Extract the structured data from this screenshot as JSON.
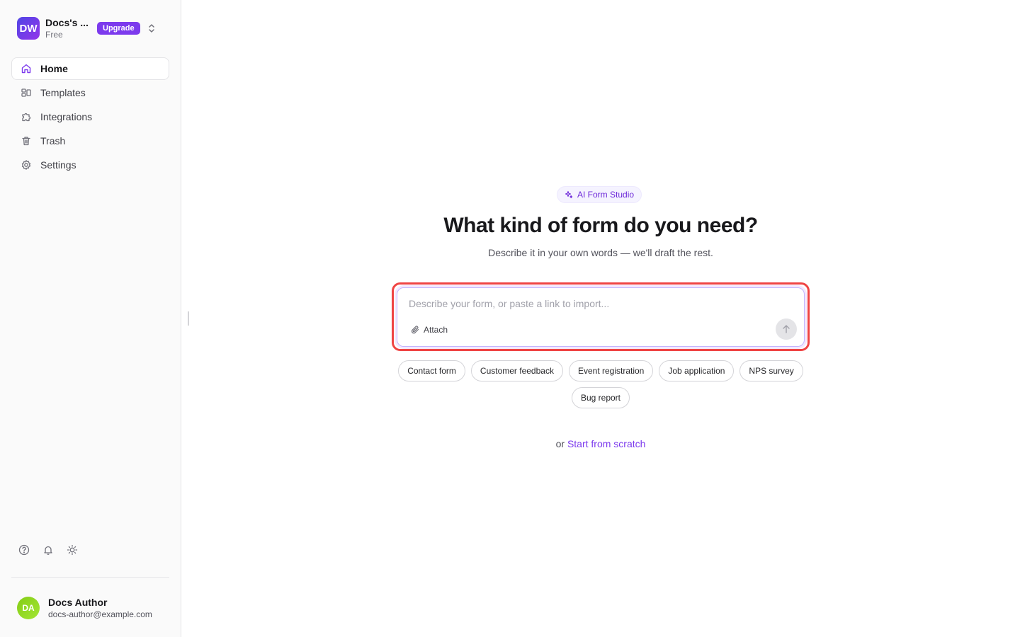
{
  "workspace": {
    "initials": "DW",
    "name": "Docs's ...",
    "plan": "Free",
    "upgrade_label": "Upgrade",
    "switcher_icon": "chevrons-up-down-icon"
  },
  "nav": {
    "items": [
      {
        "label": "Home",
        "icon": "home-icon",
        "active": true
      },
      {
        "label": "Templates",
        "icon": "templates-icon",
        "active": false
      },
      {
        "label": "Integrations",
        "icon": "puzzle-icon",
        "active": false
      },
      {
        "label": "Trash",
        "icon": "trash-icon",
        "active": false
      },
      {
        "label": "Settings",
        "icon": "gear-icon",
        "active": false
      }
    ]
  },
  "utility_icons": [
    "help-icon",
    "bell-icon",
    "sun-icon"
  ],
  "user": {
    "initials": "DA",
    "name": "Docs Author",
    "email": "docs-author@example.com"
  },
  "main": {
    "badge": "AI Form Studio",
    "title": "What kind of form do you need?",
    "subtitle": "Describe it in your own words — we'll draft the rest.",
    "prompt_placeholder": "Describe your form, or paste a link to import...",
    "prompt_value": "",
    "attach_label": "Attach",
    "suggestions": [
      "Contact form",
      "Customer feedback",
      "Event registration",
      "Job application",
      "NPS survey",
      "Bug report"
    ],
    "scratch_prefix": "or",
    "scratch_link": "Start from scratch"
  },
  "colors": {
    "accent": "#7c3aed",
    "highlight_outline": "#ef4444"
  }
}
